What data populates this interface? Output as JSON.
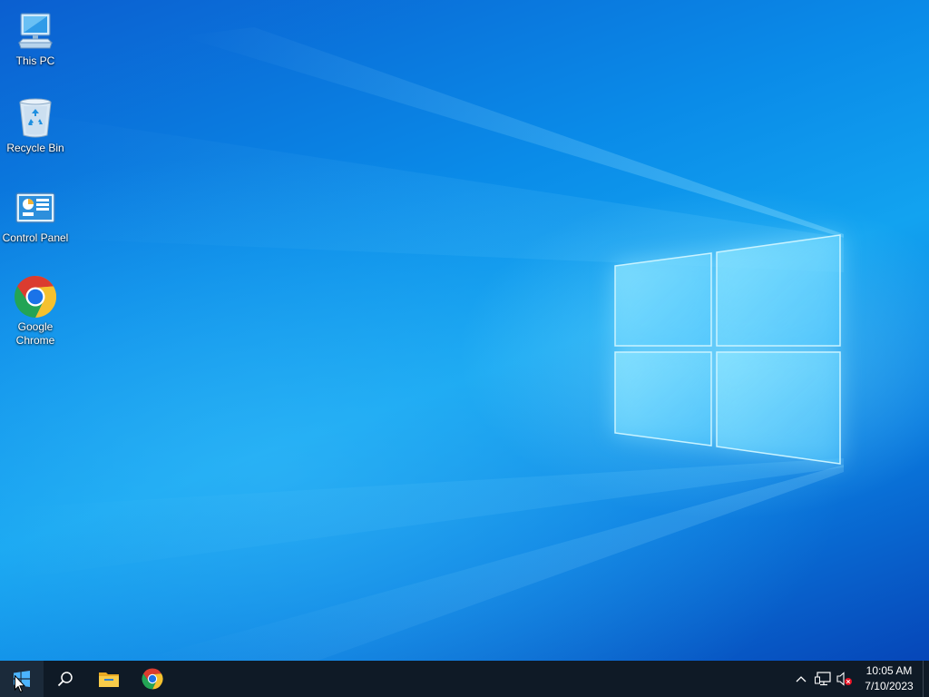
{
  "desktop": {
    "icons": [
      {
        "name": "this-pc",
        "icon": "computer-icon",
        "line1": "This PC",
        "line2": ""
      },
      {
        "name": "recycle-bin",
        "icon": "recycle-bin-icon",
        "line1": "Recycle Bin",
        "line2": ""
      },
      {
        "name": "control-panel",
        "icon": "control-panel-icon",
        "line1": "Control Panel",
        "line2": ""
      },
      {
        "name": "google-chrome",
        "icon": "chrome-icon",
        "line1": "Google",
        "line2": "Chrome"
      }
    ]
  },
  "taskbar": {
    "buttons": [
      {
        "name": "start-button",
        "icon": "windows-start-icon"
      },
      {
        "name": "search-button",
        "icon": "search-icon"
      },
      {
        "name": "file-explorer-button",
        "icon": "folder-icon"
      },
      {
        "name": "chrome-taskbar-button",
        "icon": "chrome-icon"
      }
    ],
    "tray": {
      "icons": [
        "chevron-up-icon",
        "network-icon",
        "volume-muted-icon"
      ],
      "time": "10:05 AM",
      "date": "7/10/2023"
    }
  },
  "colors": {
    "taskbar": "#0f1a26",
    "desktop_accent": "#0a8be8"
  }
}
